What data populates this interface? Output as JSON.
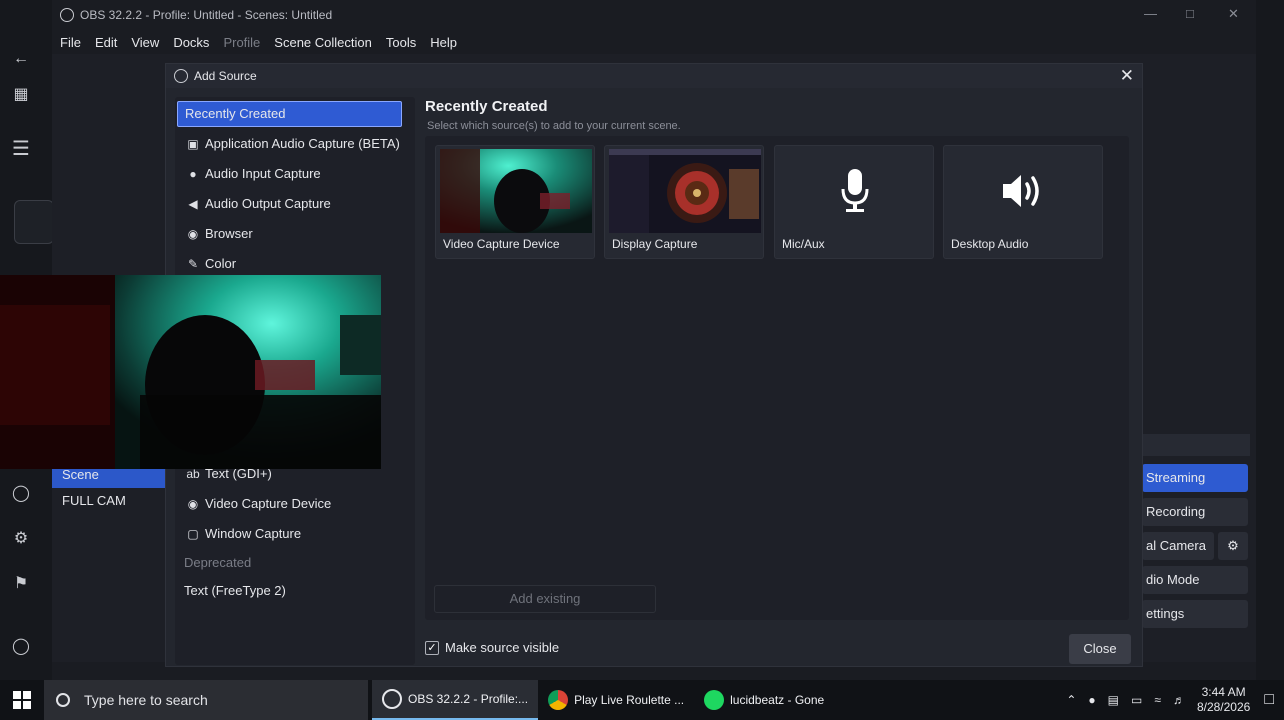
{
  "obs_window": {
    "title": "OBS 32.2.2 - Profile: Untitled - Scenes: Untitled",
    "menu": [
      "File",
      "Edit",
      "View",
      "Docks",
      "Profile",
      "Scene Collection",
      "Tools",
      "Help"
    ],
    "scenes": [
      "Scene",
      "FULL CAM"
    ],
    "controls": [
      "Streaming",
      "Recording",
      "al Camera",
      "dio Mode",
      "ettings"
    ]
  },
  "dialog": {
    "title": "Add Source",
    "heading": "Recently Created",
    "subheading": "Select which source(s) to add to your current scene.",
    "source_types": [
      {
        "label": "Recently Created",
        "icon": "none"
      },
      {
        "label": "Application Audio Capture (BETA)",
        "icon": "app-audio-icon"
      },
      {
        "label": "Audio Input Capture",
        "icon": "microphone-icon"
      },
      {
        "label": "Audio Output Capture",
        "icon": "speaker-icon"
      },
      {
        "label": "Browser",
        "icon": "globe-icon"
      },
      {
        "label": "Color",
        "icon": "brush-icon"
      },
      {
        "label": "Text (GDI+)",
        "icon": "text-icon"
      },
      {
        "label": "Video Capture Device",
        "icon": "camera-icon"
      },
      {
        "label": "Window Capture",
        "icon": "window-icon"
      }
    ],
    "deprecated_label": "Deprecated",
    "deprecated_items": [
      "Text (FreeType 2)"
    ],
    "recent_sources": [
      {
        "label": "Video Capture Device",
        "thumb": "webcam"
      },
      {
        "label": "Display Capture",
        "thumb": "roulette"
      },
      {
        "label": "Mic/Aux",
        "thumb": "microphone-icon"
      },
      {
        "label": "Desktop Audio",
        "thumb": "speaker-icon"
      }
    ],
    "add_existing": "Add existing",
    "make_visible": "Make source visible",
    "make_visible_checked": true,
    "close": "Close"
  },
  "taskbar": {
    "search_placeholder": "Type here to search",
    "tasks": [
      {
        "label": "OBS 32.2.2 - Profile:...",
        "active": true
      },
      {
        "label": "Play Live Roulette ...",
        "active": false
      },
      {
        "label": "lucidbeatz - Gone",
        "active": false
      }
    ],
    "time": "3:44 AM",
    "date": "8/28/2026"
  }
}
